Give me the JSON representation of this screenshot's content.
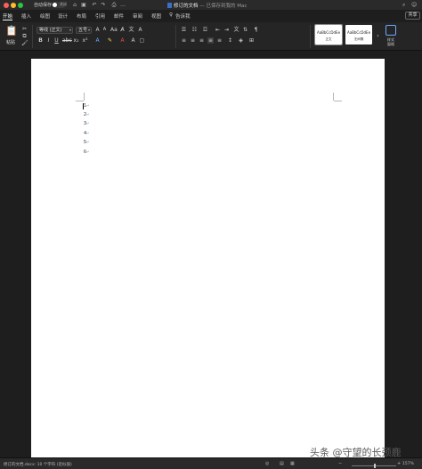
{
  "titlebar": {
    "autosave_label": "自动保存",
    "autosave_state": "关闭",
    "doc_title": "修订的文档",
    "doc_status": "— 已保存到我的 Mac",
    "quick_icons": [
      "home-icon",
      "save-icon",
      "undo-icon",
      "redo-icon",
      "print-icon",
      "more-icon"
    ]
  },
  "tabs": [
    {
      "label": "开始",
      "active": true
    },
    {
      "label": "插入"
    },
    {
      "label": "绘图"
    },
    {
      "label": "设计"
    },
    {
      "label": "布局"
    },
    {
      "label": "引用"
    },
    {
      "label": "邮件"
    },
    {
      "label": "审阅"
    },
    {
      "label": "视图"
    },
    {
      "label": "告诉我"
    }
  ],
  "share_label": "共享",
  "ribbon": {
    "paste_label": "粘贴",
    "font_name": "等线 (正文)",
    "font_size": "五号",
    "styles": [
      {
        "sample": "AaBbCcDdEe",
        "name": "正文"
      },
      {
        "sample": "AaBbCcDdEe",
        "name": "无间隔"
      }
    ],
    "styles_pane_label": "样式\n窗格",
    "accent_color": "#6aa9ff"
  },
  "document": {
    "lines": [
      "1",
      "2",
      "3",
      "4",
      "5",
      "6"
    ],
    "para_mark": "↵"
  },
  "statusbar": {
    "text": "修订的文档.docx: 10 个字符 (近似值)",
    "zoom": "157%"
  },
  "watermark": "头条 @守望的长颈鹿"
}
